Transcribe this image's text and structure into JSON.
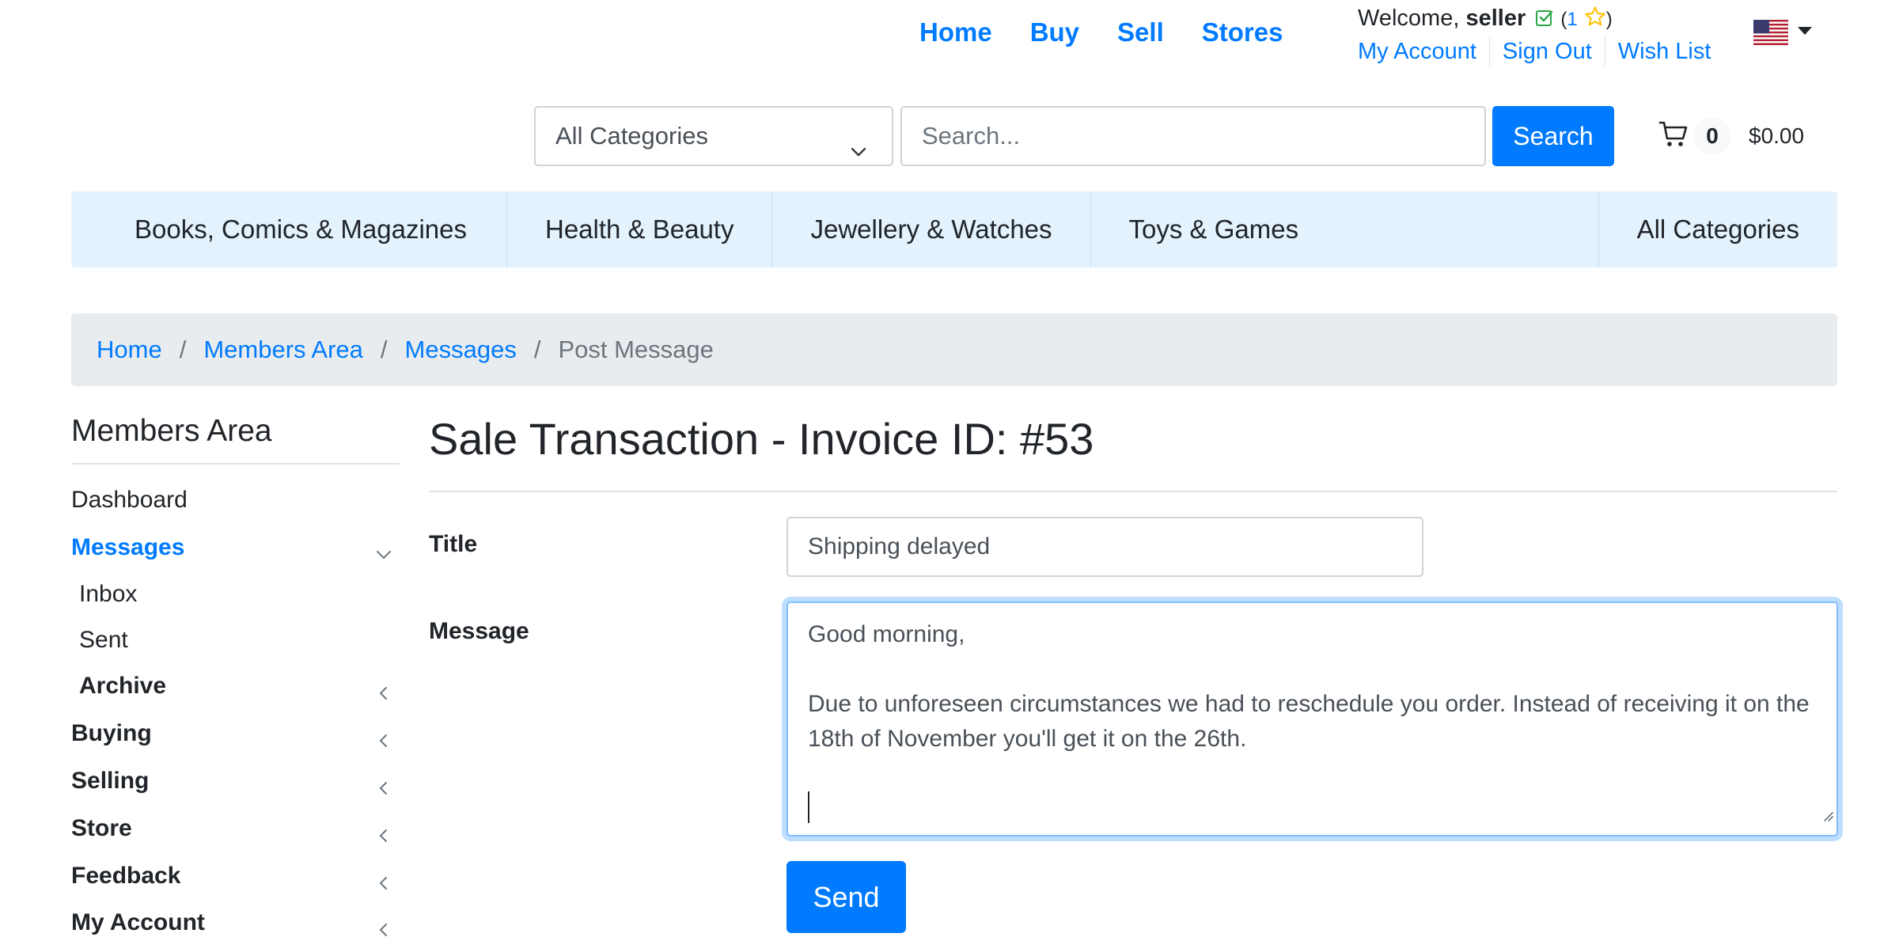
{
  "top_nav": {
    "home": "Home",
    "buy": "Buy",
    "sell": "Sell",
    "stores": "Stores"
  },
  "user": {
    "welcome": "Welcome,",
    "username": "seller",
    "paren_open": "(",
    "score": "1",
    "paren_close": ")",
    "my_account": "My Account",
    "sign_out": "Sign Out",
    "wish_list": "Wish List"
  },
  "search": {
    "category": "All Categories",
    "placeholder": "Search...",
    "button": "Search"
  },
  "cart": {
    "count": "0",
    "total": "$0.00"
  },
  "categories": [
    "Books, Comics & Magazines",
    "Health & Beauty",
    "Jewellery & Watches",
    "Toys & Games",
    "All Categories"
  ],
  "breadcrumb": {
    "items": [
      "Home",
      "Members Area",
      "Messages"
    ],
    "separator": "/",
    "current": "Post Message"
  },
  "sidebar": {
    "title": "Members Area",
    "items": {
      "dashboard": "Dashboard",
      "messages": "Messages",
      "inbox": "Inbox",
      "sent": "Sent",
      "archive": "Archive",
      "buying": "Buying",
      "selling": "Selling",
      "store": "Store",
      "feedback": "Feedback",
      "my_account": "My Account"
    }
  },
  "main": {
    "title": "Sale Transaction - Invoice ID: #53",
    "form": {
      "title_label": "Title",
      "title_value": "Shipping delayed",
      "message_label": "Message",
      "message_value": "Good morning,\n\nDue to unforeseen circumstances we had to reschedule you order. Instead of receiving it on the 18th of November you'll get it on the 26th.\n\n",
      "send": "Send"
    }
  },
  "colors": {
    "primary": "#007bff",
    "category_bar": "#e3f2fd",
    "breadcrumb_bg": "#e9ecef",
    "verified": "#28a745",
    "star": "#ffc107"
  },
  "icons": {
    "verified": "check-square-icon",
    "rating": "star-icon",
    "flag": "us-flag-icon",
    "cart": "cart-icon"
  }
}
